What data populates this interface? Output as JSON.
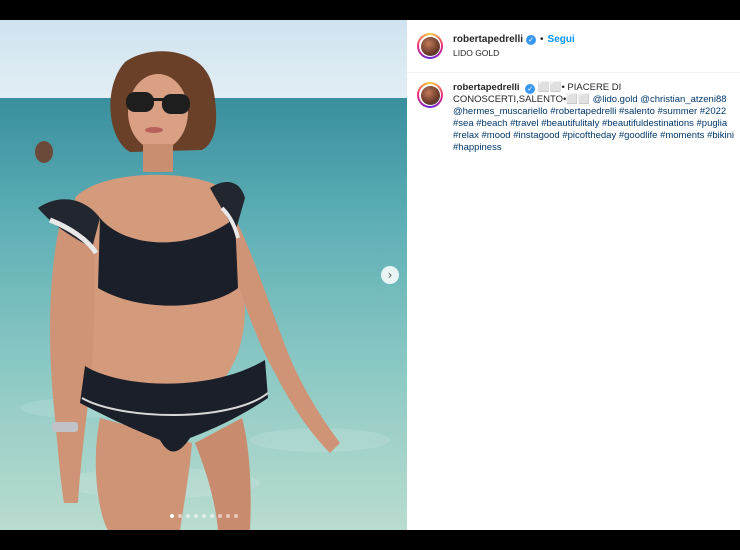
{
  "post": {
    "username": "robertapedrelli",
    "follow_label": "Segui",
    "separator": "•",
    "location": "LIDO GOLD",
    "caption": {
      "username": "robertapedrelli",
      "text": "⬜⬜• PIACERE DI CONOSCERTI,SALENTO•⬜⬜",
      "mentions": [
        "@lido.gold",
        "@christian_atzeni88",
        "@hermes_muscariello"
      ],
      "hashtags": [
        "#robertapedrelli",
        "#salento",
        "#summer",
        "#2022",
        "#sea",
        "#beach",
        "#travel",
        "#beautifulitaly",
        "#beautifuldestinations",
        "#puglia",
        "#relax",
        "#mood",
        "#instagood",
        "#picoftheday",
        "#goodlife",
        "#moments",
        "#bikini",
        "#happiness"
      ]
    },
    "carousel": {
      "total": 9,
      "active": 1
    },
    "next_icon": "chevron-right-icon"
  },
  "colors": {
    "link": "#00376b",
    "follow": "#0095f6",
    "verified": "#3897f0"
  }
}
